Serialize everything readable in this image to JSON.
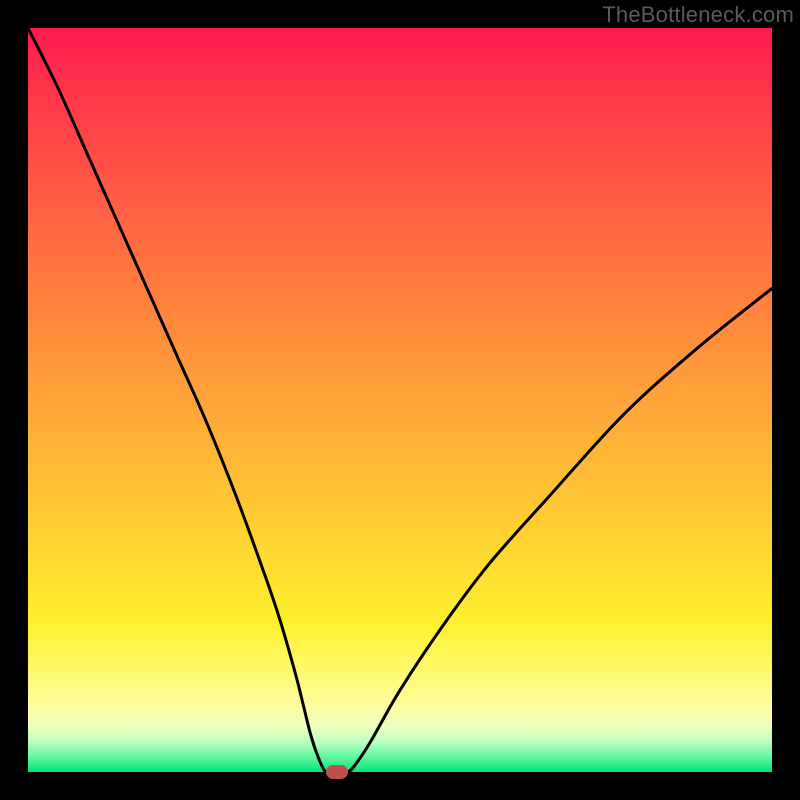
{
  "watermark": "TheBottleneck.com",
  "colors": {
    "curve": "#000000",
    "marker": "#c0504d",
    "frame": "#000000"
  },
  "chart_data": {
    "type": "line",
    "title": "",
    "xlabel": "",
    "ylabel": "",
    "xlim": [
      0,
      100
    ],
    "ylim": [
      0,
      100
    ],
    "grid": false,
    "series": [
      {
        "name": "bottleneck-curve",
        "x": [
          0,
          4,
          8,
          12,
          16,
          20,
          24,
          28,
          32,
          34,
          36,
          37,
          38,
          39,
          40,
          41,
          42,
          43,
          44,
          46,
          50,
          56,
          62,
          70,
          80,
          90,
          100
        ],
        "y": [
          100,
          92,
          83,
          74,
          65,
          56,
          47,
          37,
          26,
          20,
          13,
          9,
          5,
          2,
          0,
          0,
          0,
          0,
          1,
          4,
          11,
          20,
          28,
          37,
          48,
          57,
          65
        ]
      }
    ],
    "marker": {
      "x": 41.5,
      "y": 0
    }
  }
}
